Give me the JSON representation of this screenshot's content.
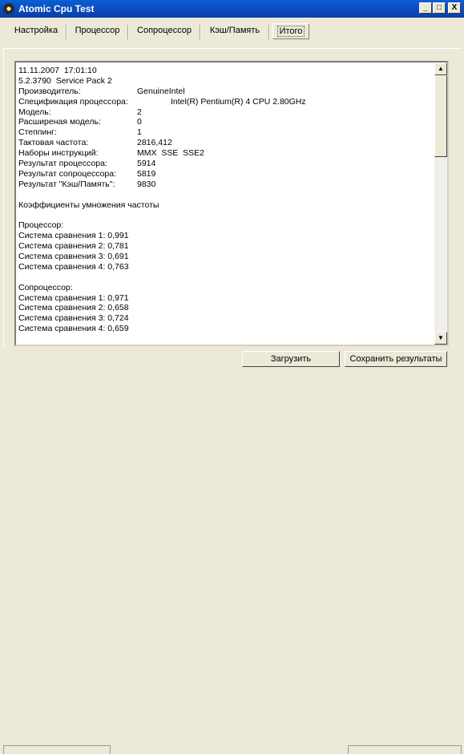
{
  "window": {
    "title": "Atomic Cpu Test",
    "buttons": {
      "min": "_",
      "max": "□",
      "close": "X"
    }
  },
  "tabs": [
    {
      "label": "Настройка",
      "active": false
    },
    {
      "label": "Процессор",
      "active": false
    },
    {
      "label": "Сопроцессор",
      "active": false
    },
    {
      "label": "Кэш/Память",
      "active": false
    },
    {
      "label": "Итого",
      "active": true
    }
  ],
  "report": {
    "datetime": "11.11.2007  17:01:10",
    "os": "5.2.3790  Service Pack 2",
    "rows": [
      {
        "key": "Производитель:",
        "value": "GenuineIntel"
      },
      {
        "key": "Спецификация процессора:",
        "value": "Intel(R) Pentium(R) 4 CPU 2.80GHz"
      },
      {
        "key": "Модель:",
        "value": "2"
      },
      {
        "key": "Расширеная модель:",
        "value": "0"
      },
      {
        "key": "Степпинг:",
        "value": "1"
      },
      {
        "key": "Тактовая частота:",
        "value": "2816,412"
      },
      {
        "key": "Наборы инструкций:",
        "value": "MMX  SSE  SSE2"
      },
      {
        "key": "Результат процессора:",
        "value": "5914"
      },
      {
        "key": "Результат сопроцессора:",
        "value": "5819"
      },
      {
        "key": "Результат \"Кэш/Память\":",
        "value": "9830"
      }
    ],
    "multipliers_title": "Коэффициенты умножения частоты",
    "cpu_title": "Процессор:",
    "cpu_lines": [
      "Система сравнения 1: 0,991",
      "Система сравнения 2: 0,781",
      "Система сравнения 3: 0,691",
      "Система сравнения 4: 0,763"
    ],
    "fpu_title": "Сопроцессор:",
    "fpu_lines": [
      "Система сравнения 1: 0,971",
      "Система сравнения 2: 0,658",
      "Система сравнения 3: 0,724",
      "Система сравнения 4: 0,659"
    ]
  },
  "scrollbar": {
    "up": "▲",
    "down": "▼"
  },
  "actions": {
    "load": "Загрузить",
    "save": "Сохранить результаты"
  }
}
